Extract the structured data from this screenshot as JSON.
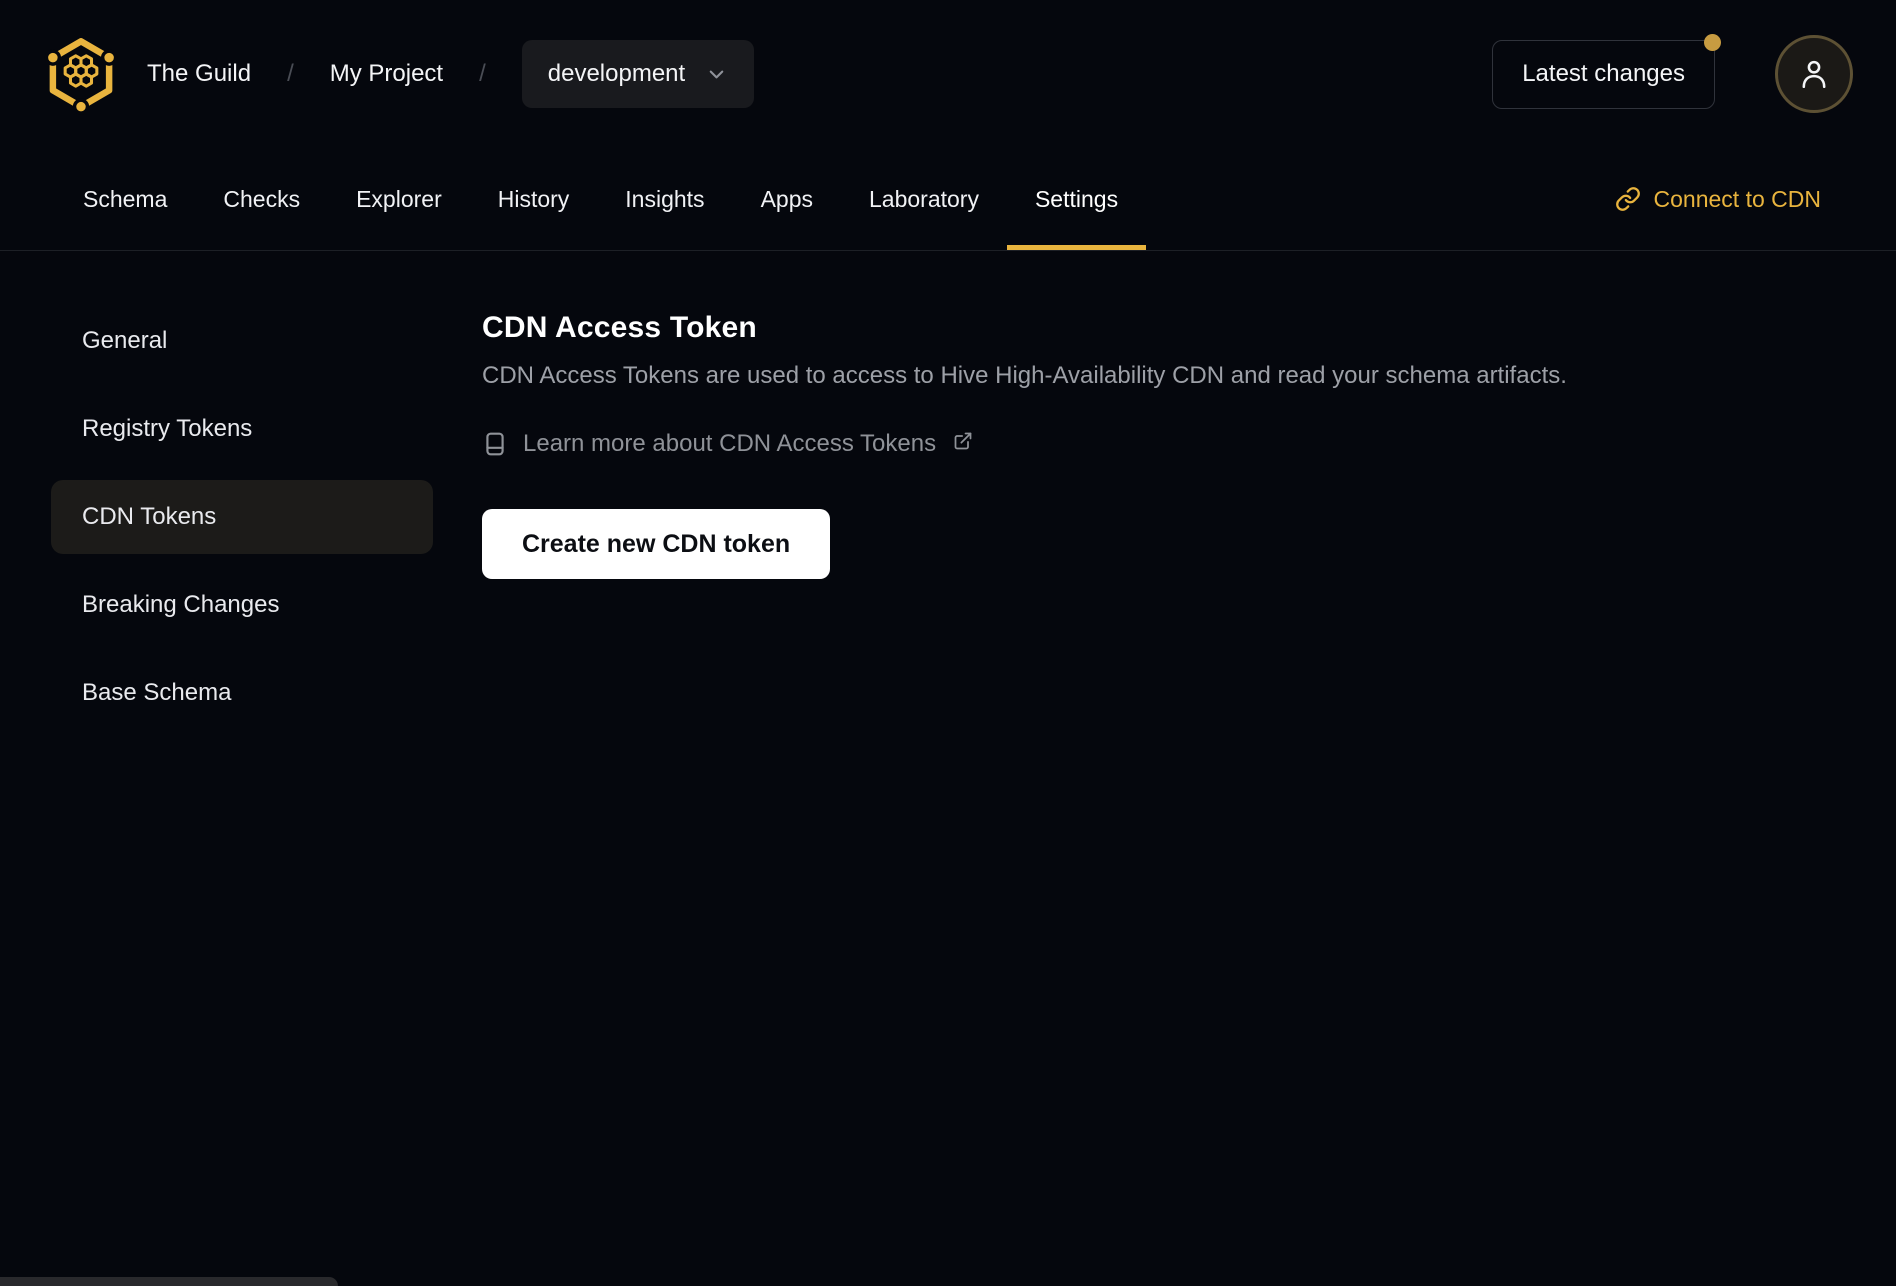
{
  "header": {
    "breadcrumb": {
      "org": "The Guild",
      "project": "My Project",
      "separator": "/",
      "target": "development"
    },
    "latest_changes_label": "Latest changes"
  },
  "tabs": [
    {
      "label": "Schema"
    },
    {
      "label": "Checks"
    },
    {
      "label": "Explorer"
    },
    {
      "label": "History"
    },
    {
      "label": "Insights"
    },
    {
      "label": "Apps"
    },
    {
      "label": "Laboratory"
    },
    {
      "label": "Settings",
      "active": true
    }
  ],
  "connect_cdn": {
    "label": "Connect to CDN"
  },
  "sidebar": {
    "items": [
      {
        "label": "General"
      },
      {
        "label": "Registry Tokens"
      },
      {
        "label": "CDN Tokens",
        "active": true
      },
      {
        "label": "Breaking Changes"
      },
      {
        "label": "Base Schema"
      }
    ]
  },
  "main": {
    "title": "CDN Access Token",
    "description": "CDN Access Tokens are used to access to Hive High-Availability CDN and read your schema artifacts.",
    "learn_more_label": "Learn more about CDN Access Tokens",
    "create_button_label": "Create new CDN token"
  },
  "icons": {
    "logo": "hive-honeycomb-logo",
    "chevron": "chevron-down-icon",
    "user": "user-icon",
    "link": "link-icon",
    "book": "book-icon",
    "external": "external-link-icon"
  },
  "colors": {
    "accent": "#e9b43e",
    "background": "#05070d",
    "active_item_bg": "#1c1b19",
    "button_bg": "#ffffff"
  }
}
